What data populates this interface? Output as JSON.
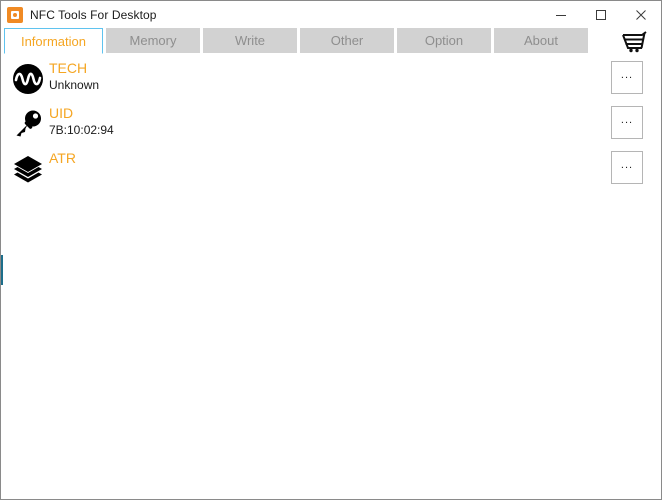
{
  "window": {
    "title": "NFC Tools For Desktop",
    "app_icon": "nfc-app-icon",
    "controls": {
      "minimize": "minimize-icon",
      "maximize": "maximize-icon",
      "close": "close-icon"
    }
  },
  "tabs": [
    {
      "label": "Information",
      "active": true
    },
    {
      "label": "Memory",
      "active": false
    },
    {
      "label": "Write",
      "active": false
    },
    {
      "label": "Other",
      "active": false
    },
    {
      "label": "Option",
      "active": false
    },
    {
      "label": "About",
      "active": false
    }
  ],
  "toolbar": {
    "cart_icon": "shopping-cart-icon"
  },
  "info_rows": [
    {
      "icon": "nfc-wave-icon",
      "title": "TECH",
      "value": "Unknown",
      "action_label": "..."
    },
    {
      "icon": "key-icon",
      "title": "UID",
      "value": "7B:10:02:94",
      "action_label": "..."
    },
    {
      "icon": "layers-icon",
      "title": "ATR",
      "value": "",
      "action_label": "..."
    }
  ],
  "colors": {
    "accent_orange": "#f5a623",
    "tab_active_border": "#5fc3ef",
    "tab_inactive_bg": "#d2d2d2",
    "tab_inactive_text": "#8e8e8e",
    "app_icon_bg": "#f08a24",
    "left_accent": "#1d6e8b"
  }
}
